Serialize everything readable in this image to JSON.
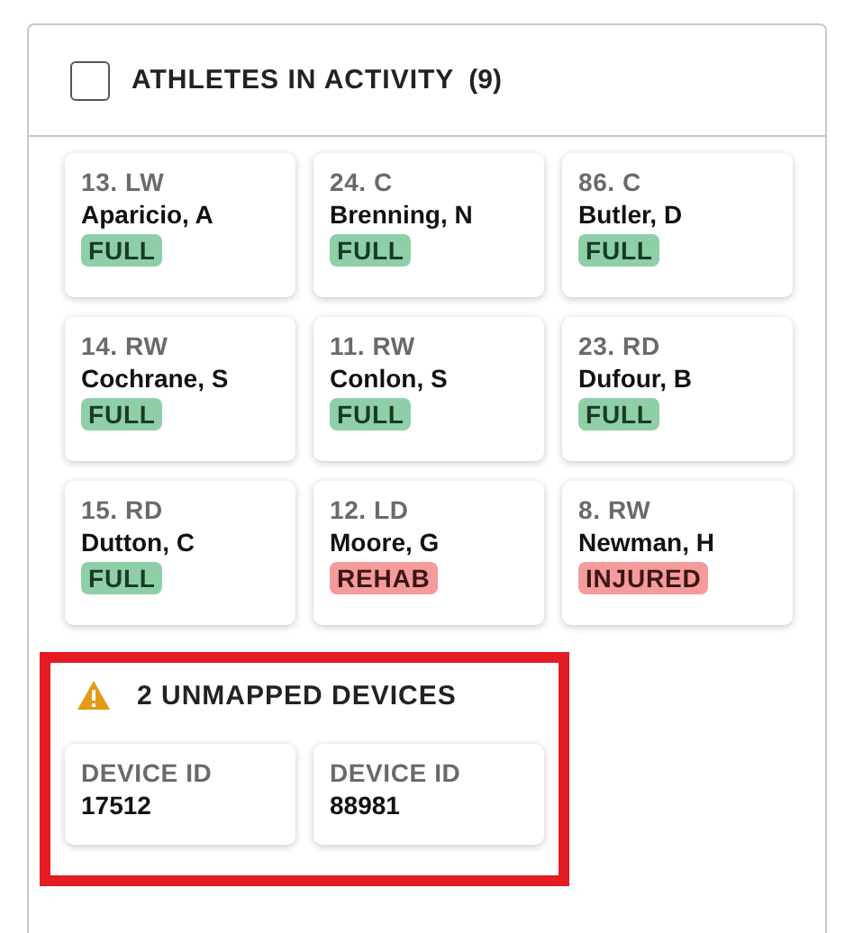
{
  "panel": {
    "checkbox": {
      "checked": false
    },
    "title": "ATHLETES IN ACTIVITY",
    "count": "(9)"
  },
  "athletes": [
    {
      "position": "13. LW",
      "name": "Aparicio, A",
      "status": "FULL",
      "kind": "full"
    },
    {
      "position": "24. C",
      "name": "Brenning, N",
      "status": "FULL",
      "kind": "full"
    },
    {
      "position": "86. C",
      "name": "Butler, D",
      "status": "FULL",
      "kind": "full"
    },
    {
      "position": "14. RW",
      "name": "Cochrane, S",
      "status": "FULL",
      "kind": "full"
    },
    {
      "position": "11. RW",
      "name": "Conlon, S",
      "status": "FULL",
      "kind": "full"
    },
    {
      "position": "23. RD",
      "name": "Dufour, B",
      "status": "FULL",
      "kind": "full"
    },
    {
      "position": "15. RD",
      "name": "Dutton, C",
      "status": "FULL",
      "kind": "full"
    },
    {
      "position": "12. LD",
      "name": "Moore, G",
      "status": "REHAB",
      "kind": "rehab"
    },
    {
      "position": "8. RW",
      "name": "Newman, H",
      "status": "INJURED",
      "kind": "injured"
    }
  ],
  "unmapped": {
    "highlighted": true,
    "title": "2 UNMAPPED DEVICES",
    "devices": [
      {
        "label": "DEVICE ID",
        "value": "17512"
      },
      {
        "label": "DEVICE ID",
        "value": "88981"
      }
    ]
  }
}
